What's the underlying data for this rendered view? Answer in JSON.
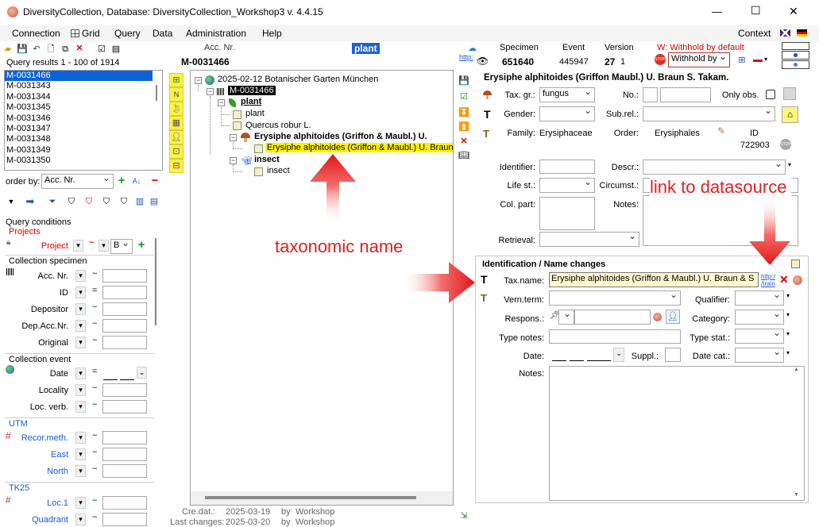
{
  "titlebar": {
    "title": "DiversityCollection,  Database: DiversityCollection_Workshop3    v. 4.4.15",
    "minimize": "—",
    "maximize": "☐",
    "close": "✕"
  },
  "menu": {
    "items": [
      "Connection",
      "Grid",
      "Query",
      "Data",
      "Administration",
      "Help"
    ],
    "context": "Context"
  },
  "left": {
    "acc_caption": "Acc. Nr.",
    "acc_value": "M-0031466",
    "plant_badge": "plant",
    "query_results": "Query results   1 - 100 of 1914",
    "results": [
      "M-0031466",
      "M-0031343",
      "M-0031344",
      "M-0031345",
      "M-0031346",
      "M-0031347",
      "M-0031348",
      "M-0031349",
      "M-0031350"
    ],
    "order_by": "order by:",
    "order_value": "Acc. Nr.",
    "query_conditions": "Query conditions",
    "projects": "Projects",
    "project_label": "Project",
    "project_op": "~",
    "project_value": "B",
    "collection_specimen": "Collection specimen",
    "spec_fields": [
      {
        "label": "Acc. Nr.",
        "op": "~"
      },
      {
        "label": "ID",
        "op": "="
      },
      {
        "label": "Depositor",
        "op": "~"
      },
      {
        "label": "Dep.Acc.Nr.",
        "op": "~"
      },
      {
        "label": "Original",
        "op": "~"
      }
    ],
    "collection_event": "Collection event",
    "event_fields": [
      {
        "label": "Date",
        "op": "="
      },
      {
        "label": "Locality",
        "op": "~"
      },
      {
        "label": "Loc. verb.",
        "op": "~"
      }
    ],
    "utm": "UTM",
    "utm_fields": [
      {
        "label": "Recor.meth.",
        "op": "~"
      },
      {
        "label": "East",
        "op": "~"
      },
      {
        "label": "North",
        "op": "~"
      }
    ],
    "tk25": "TK25",
    "tk25_fields": [
      {
        "label": "Loc.1",
        "op": "~"
      },
      {
        "label": "Quadrant",
        "op": "~"
      }
    ]
  },
  "tree": {
    "root": "2025-02-12 Botanischer Garten München",
    "specimen": "M-0031466",
    "plant_group": "plant",
    "plant_child1": "plant",
    "plant_child2": "Quercus robur L.",
    "fungus_group": "Erysiphe alphitoides (Griffon & Maubl.) U.",
    "fungus_child": "Erysiphe alphitoides (Griffon & Maubl.) U. Braun &",
    "insect_group": "insect",
    "insect_child": "insect",
    "cre_label": "Cre.dat.:",
    "cre_date": "2025-03-19",
    "cre_by": "by",
    "cre_user": "Workshop",
    "last_label": "Last changes:",
    "last_date": "2025-03-20",
    "last_by": "by",
    "last_user": "Workshop"
  },
  "header": {
    "link": "http:",
    "specimen_label": "Specimen",
    "specimen_value": "651640",
    "event_label": "Event",
    "event_value": "445947",
    "version_label": "Version",
    "version_value": "27",
    "version_sub": "1",
    "withhold_label": "W: Withhold by default",
    "withhold_value": "Withhold by"
  },
  "unit": {
    "title": "Erysiphe alphitoides (Griffon  Maubl.) U. Braun  S. Takam.",
    "tax_gr_label": "Tax. gr.:",
    "tax_gr_value": "fungus",
    "no_label": "No.:",
    "only_obs": "Only obs.",
    "gender_label": "Gender:",
    "subrel_label": "Sub.rel.:",
    "family_label": "Family:",
    "family_value": "Erysiphaceae",
    "order_label": "Order:",
    "order_value": "Erysiphales",
    "id_label": "ID",
    "id_value": "722903",
    "identifier_label": "Identifier:",
    "descr_label": "Descr.:",
    "lifest_label": "Life st.:",
    "circumst_label": "Circumst.:",
    "colpart_label": "Col. part:",
    "notes_label": "Notes:",
    "retrieval_label": "Retrieval:"
  },
  "ident": {
    "title": "Identification / Name changes",
    "taxname_label": "Tax.name:",
    "taxname_value": "Erysiphe alphitoides (Griffon & Maubl.) U. Braun & S",
    "link1": "http:/",
    "link2": "/train",
    "vern_label": "Vern.term:",
    "qualifier_label": "Qualifier:",
    "respons_label": "Respons.:",
    "category_label": "Category:",
    "typenotes_label": "Type notes:",
    "typestat_label": "Type stat.:",
    "date_label": "Date:",
    "date_value": "__ __ ____",
    "suppl_label": "Suppl.:",
    "datecat_label": "Date cat.:",
    "notes_label": "Notes:"
  },
  "annotations": {
    "taxonomic_name": "taxonomic name",
    "link_to_datasource": "link to datasource",
    "color": "#e02020"
  }
}
